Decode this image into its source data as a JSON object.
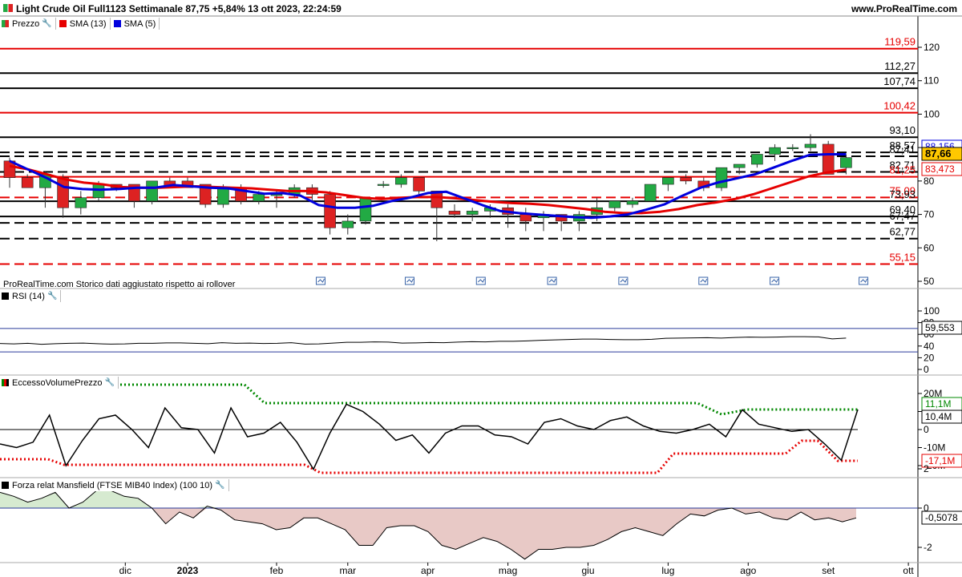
{
  "header": {
    "title": "Light Crude Oil Full1123 Settimanale 87,75 +5,84% 13 ott 2023, 22:24:59",
    "site": "www.ProRealTime.com"
  },
  "legend": {
    "price": "Prezzo",
    "sma13": "SMA (13)",
    "sma5": "SMA (5)",
    "colors": {
      "bull": "#22aa44",
      "bear": "#dd2222",
      "sma13": "#e60000",
      "sma5": "#0000dd"
    }
  },
  "note": "ProRealTime.com Storico dati aggiustato rispetto ai rollover",
  "chart_data": [
    {
      "type": "candlestick",
      "title": "Light Crude Oil Full1123 Settimanale",
      "ylim": [
        50,
        125
      ],
      "yticks": [
        50,
        60,
        70,
        80,
        90,
        100,
        110,
        120
      ],
      "ytick_labels": [
        "50",
        "60",
        "70",
        "80",
        "90",
        "100",
        "110",
        "120"
      ],
      "xtick_labels": [
        {
          "x": 6.5,
          "label": "dic"
        },
        {
          "x": 10,
          "label": "2023"
        },
        {
          "x": 15,
          "label": "feb"
        },
        {
          "x": 19,
          "label": "mar"
        },
        {
          "x": 23.5,
          "label": "apr"
        },
        {
          "x": 28,
          "label": "mag"
        },
        {
          "x": 32.5,
          "label": "giu"
        },
        {
          "x": 37,
          "label": "lug"
        },
        {
          "x": 41.5,
          "label": "ago"
        },
        {
          "x": 46,
          "label": "set"
        },
        {
          "x": 50.5,
          "label": "ott"
        }
      ],
      "candles": [
        [
          86,
          87,
          78,
          81
        ],
        [
          81,
          82,
          78,
          78
        ],
        [
          78,
          83,
          72,
          82
        ],
        [
          81,
          82,
          69,
          72
        ],
        [
          72,
          77,
          70,
          75
        ],
        [
          75,
          80,
          74,
          79
        ],
        [
          79,
          79,
          77,
          78
        ],
        [
          79,
          79,
          72,
          74
        ],
        [
          74,
          80,
          73,
          80
        ],
        [
          80,
          81,
          78,
          78
        ],
        [
          80,
          81,
          78,
          78
        ],
        [
          79,
          79,
          72,
          73
        ],
        [
          73,
          79,
          72,
          78
        ],
        [
          78,
          79,
          73,
          74
        ],
        [
          74,
          77,
          73,
          76
        ],
        [
          76,
          77,
          72,
          76
        ],
        [
          76,
          79,
          75,
          78
        ],
        [
          78,
          79,
          74,
          76
        ],
        [
          76,
          77,
          64,
          66
        ],
        [
          66,
          70,
          64,
          68
        ],
        [
          68,
          75,
          67,
          75
        ],
        [
          79,
          80,
          78,
          79
        ],
        [
          79,
          82,
          78,
          81
        ],
        [
          81,
          81,
          76,
          77
        ],
        [
          77,
          77,
          62,
          72
        ],
        [
          71,
          73,
          69,
          70
        ],
        [
          70,
          72,
          68,
          71
        ],
        [
          71,
          73,
          69,
          72
        ],
        [
          72,
          73,
          66,
          70
        ],
        [
          70,
          72,
          65,
          68
        ],
        [
          69,
          71,
          65,
          70
        ],
        [
          70,
          70,
          65,
          68
        ],
        [
          68,
          71,
          65,
          70
        ],
        [
          70,
          75,
          68,
          72
        ],
        [
          72,
          74,
          71,
          74
        ],
        [
          73,
          75,
          72,
          74
        ],
        [
          74,
          79,
          74,
          79
        ],
        [
          79,
          81,
          77,
          81
        ],
        [
          81,
          82,
          79,
          80
        ],
        [
          80,
          81,
          77,
          78
        ],
        [
          78,
          84,
          77,
          84
        ],
        [
          84,
          85,
          82,
          85
        ],
        [
          85,
          88,
          84,
          88
        ],
        [
          88,
          91,
          86,
          90
        ],
        [
          90,
          91,
          89,
          90
        ],
        [
          90,
          94,
          89,
          91
        ],
        [
          91,
          92,
          82,
          82
        ],
        [
          84,
          88,
          82,
          87
        ]
      ],
      "sma13": [
        84.5,
        83.5,
        82,
        80.5,
        79.5,
        79,
        78.2,
        78,
        78,
        78.2,
        78.4,
        78.2,
        78,
        77.8,
        77.4,
        77,
        77,
        76.6,
        75.8,
        75,
        74.6,
        75,
        75.2,
        75.2,
        74.8,
        74.3,
        73.8,
        73.4,
        73.2,
        72.8,
        72.2,
        71.6,
        70.8,
        70.4,
        70.4,
        70.8,
        71.6,
        72.8,
        73.6,
        74.6,
        76,
        77.8,
        79.6,
        81.4,
        82.6,
        83.4
      ],
      "sma5": [
        86,
        83.5,
        81,
        78.2,
        77.6,
        77.4,
        77.6,
        78,
        78,
        78.8,
        78.4,
        78,
        77.8,
        77,
        76.2,
        76.4,
        75.6,
        72.8,
        72,
        72,
        72.6,
        74,
        75,
        76.4,
        76.8,
        74.8,
        72.8,
        71,
        70.4,
        70,
        69.6,
        69.2,
        69,
        69.4,
        70,
        71.4,
        73,
        75.6,
        78,
        79.6,
        80.8,
        82,
        84,
        86,
        87.8,
        88,
        88
      ],
      "hlines": [
        {
          "value": 119.59,
          "label": "119,59",
          "color": "red",
          "style": "solid"
        },
        {
          "value": 112.27,
          "label": "112,27",
          "color": "black",
          "style": "solid"
        },
        {
          "value": 107.74,
          "label": "107,74",
          "color": "black",
          "style": "solid"
        },
        {
          "value": 100.42,
          "label": "100,42",
          "color": "red",
          "style": "solid"
        },
        {
          "value": 93.1,
          "label": "93,10",
          "color": "black",
          "style": "solid"
        },
        {
          "value": 88.57,
          "label": "88,57",
          "color": "black",
          "style": "dashed"
        },
        {
          "value": 87.41,
          "label": "87,41",
          "color": "black",
          "style": "dashed"
        },
        {
          "value": 82.71,
          "label": "82,71",
          "color": "black",
          "style": "dashed"
        },
        {
          "value": 81.25,
          "label": "81,25",
          "color": "red",
          "style": "solid"
        },
        {
          "value": 75.09,
          "label": "75,09",
          "color": "red",
          "style": "dashed"
        },
        {
          "value": 73.93,
          "label": "73,93",
          "color": "black",
          "style": "solid"
        },
        {
          "value": 69.4,
          "label": "69,40",
          "color": "black",
          "style": "solid"
        },
        {
          "value": 67.47,
          "label": "67,47",
          "color": "black",
          "style": "dashed"
        },
        {
          "value": 62.77,
          "label": "62,77",
          "color": "black",
          "style": "dashed"
        },
        {
          "value": 55.15,
          "label": "55,15",
          "color": "red",
          "style": "dashed"
        }
      ],
      "badges": [
        {
          "value": 88.156,
          "label": "88,156",
          "fg": "#0000dd",
          "bg": "#ffffff",
          "border": "#0000dd",
          "bold": false
        },
        {
          "value": 87.66,
          "label": "87,66",
          "fg": "#000000",
          "bg": "#ffc800",
          "border": "#000000",
          "bold": true
        },
        {
          "value": 83.473,
          "label": "83,473",
          "fg": "#e60000",
          "bg": "#ffffff",
          "border": "#e60000",
          "bold": false
        }
      ],
      "event_markers": [
        17.5,
        22.5,
        26.5,
        30.5,
        34.5,
        39,
        43,
        48
      ]
    },
    {
      "type": "line",
      "title": "RSI (14)",
      "ylim": [
        -5,
        105
      ],
      "yticks": [
        0,
        20,
        40,
        60,
        80,
        100
      ],
      "ytick_labels": [
        "0",
        "20",
        "40",
        "60",
        "80",
        "100"
      ],
      "levels": [
        70,
        30
      ],
      "values": [
        43,
        41,
        44,
        39,
        42,
        44,
        45,
        42,
        40,
        41,
        44,
        44,
        46,
        46,
        44,
        42,
        47,
        44,
        45,
        43,
        44,
        47,
        40,
        41,
        45,
        49,
        49,
        51,
        50,
        45,
        46,
        48,
        47,
        50,
        52,
        51,
        54,
        54,
        56,
        59,
        61,
        63,
        65,
        65,
        63,
        62,
        62,
        64,
        69,
        70,
        71,
        72,
        70,
        73,
        75,
        74,
        75,
        77,
        77,
        76,
        66,
        70
      ],
      "last_badge": "59,553"
    },
    {
      "type": "line",
      "title": "EccessoVolumePrezzo",
      "ylim": [
        -25,
        25
      ],
      "yticks": [
        -20,
        -10,
        0,
        10,
        20
      ],
      "ytick_labels": [
        "-20M",
        "-10M",
        "0",
        "10M",
        "20M"
      ],
      "upper_band": [
        13,
        13,
        13,
        13,
        13,
        13,
        13,
        13,
        13,
        13,
        13,
        13,
        13,
        13,
        13,
        13,
        13,
        13,
        13,
        13,
        13,
        13,
        13,
        13,
        13,
        13,
        13,
        13,
        13,
        13,
        13,
        13,
        13,
        13,
        13,
        13,
        13,
        13,
        13,
        13,
        13,
        13,
        13,
        13,
        13,
        13,
        13,
        13,
        13,
        13,
        13,
        13,
        13,
        13,
        13,
        13,
        13,
        13,
        13,
        13,
        13,
        13,
        13,
        13,
        13,
        13,
        13,
        13,
        13,
        13,
        13,
        13,
        13,
        13,
        13,
        13,
        13,
        13,
        13,
        13,
        13,
        13,
        13,
        13,
        13,
        13,
        13,
        13,
        13,
        13,
        13,
        13,
        13,
        13,
        13,
        13,
        13,
        13,
        13,
        13,
        13,
        13,
        13,
        13,
        13,
        13,
        13,
        13,
        13,
        13,
        13,
        13,
        13,
        13,
        13,
        13,
        13,
        13,
        13,
        13,
        13,
        13,
        13,
        13,
        13,
        13,
        13,
        13,
        13,
        13
      ],
      "main": [
        -8,
        -10,
        -7,
        8,
        -20,
        -6,
        6,
        8,
        0,
        -10,
        12,
        1,
        0,
        -13,
        12,
        -4,
        -2,
        4,
        -7,
        -22,
        -2,
        14,
        10,
        3,
        -6,
        -3,
        -13,
        -2,
        2,
        2,
        -3,
        -4,
        -8,
        4,
        6,
        2,
        0,
        5,
        7,
        2,
        -1,
        -2,
        0,
        3,
        -4,
        11,
        3,
        1,
        -1,
        0,
        -8,
        -17,
        11.1
      ],
      "lower_band": [
        -17,
        -17,
        -17,
        -18,
        -20,
        -20,
        -20,
        -20,
        -20,
        -20,
        -22,
        -22,
        -22,
        -22,
        -22,
        -22,
        -22,
        -22,
        -22,
        -22,
        -12,
        -12,
        -12,
        -12,
        -12,
        -12,
        -12,
        -6,
        -6,
        -15,
        -17
      ],
      "badges": [
        {
          "label": "11,1M",
          "color": "#008800"
        },
        {
          "label": "10,4M",
          "color": "#000000"
        },
        {
          "label": "-17,1M",
          "color": "#e60000"
        }
      ]
    },
    {
      "type": "area",
      "title": "Forza relat Mansfield (FTSE MIB40 Index) (100 10)",
      "ylim": [
        -3,
        2
      ],
      "yticks": [
        -2,
        0,
        2
      ],
      "ytick_labels": [
        "-2",
        "0",
        "2"
      ],
      "values": [
        0.8,
        0.6,
        0.3,
        0.5,
        0.8,
        0.0,
        0.3,
        0.9,
        0.9,
        0.6,
        0.5,
        0.0,
        -0.8,
        -0.2,
        -0.5,
        0.1,
        -0.1,
        -0.6,
        -0.7,
        -0.8,
        -1.1,
        -1.0,
        -0.5,
        -0.5,
        -0.8,
        -1.1,
        -1.9,
        -1.9,
        -1.0,
        -0.9,
        -0.9,
        -1.2,
        -1.9,
        -2.1,
        -1.8,
        -1.5,
        -1.7,
        -2.1,
        -2.6,
        -2.1,
        -2.1,
        -2.0,
        -2.0,
        -1.9,
        -1.6,
        -1.2,
        -1.0,
        -1.2,
        -1.4,
        -0.8,
        -0.3,
        -0.4,
        -0.1,
        0.0,
        -0.3,
        -0.2,
        -0.5,
        -0.6,
        -0.2,
        -0.6,
        -0.5,
        -0.7,
        -0.5
      ],
      "last_badge": "-0,5078"
    }
  ]
}
